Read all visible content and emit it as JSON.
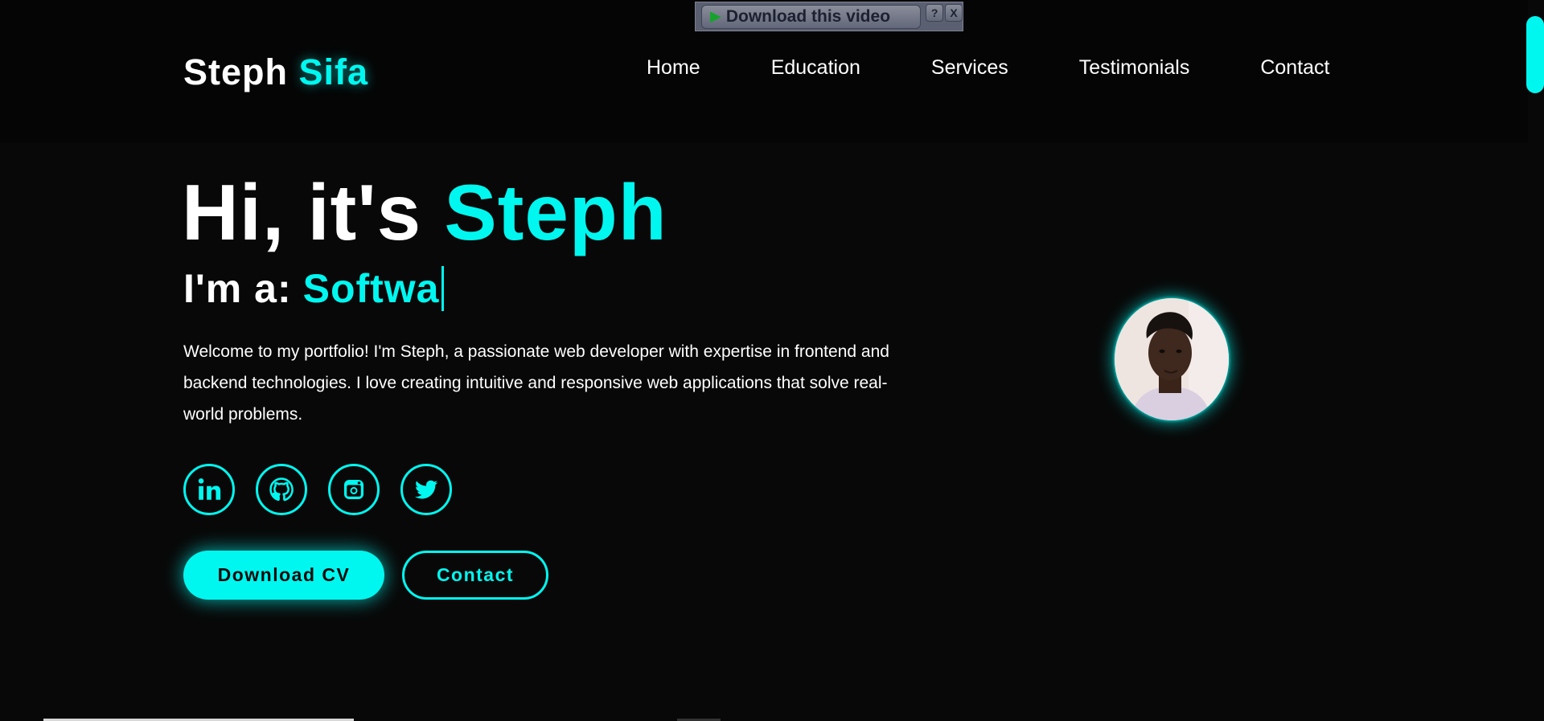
{
  "extension": {
    "download_label": "Download this video",
    "help_label": "?",
    "close_label": "X"
  },
  "header": {
    "logo_first": "Steph",
    "logo_accent": "Sifa",
    "nav": [
      {
        "label": "Home"
      },
      {
        "label": "Education"
      },
      {
        "label": "Services"
      },
      {
        "label": "Testimonials"
      },
      {
        "label": "Contact"
      }
    ]
  },
  "hero": {
    "greeting": "Hi, it's",
    "name": "Steph",
    "role_prefix": "I'm a:",
    "role_typed": "Softwa",
    "intro": "Welcome to my portfolio! I'm Steph, a passionate web developer with expertise in frontend and backend technologies. I love creating intuitive and responsive web applications that solve real-world problems.",
    "socials": [
      {
        "icon": "linkedin-icon"
      },
      {
        "icon": "github-icon"
      },
      {
        "icon": "instagram-icon"
      },
      {
        "icon": "twitter-icon"
      }
    ],
    "download_cv_label": "Download CV",
    "contact_label": "Contact"
  },
  "colors": {
    "accent": "#00f7f0",
    "background": "#080808",
    "text": "#ffffff"
  }
}
